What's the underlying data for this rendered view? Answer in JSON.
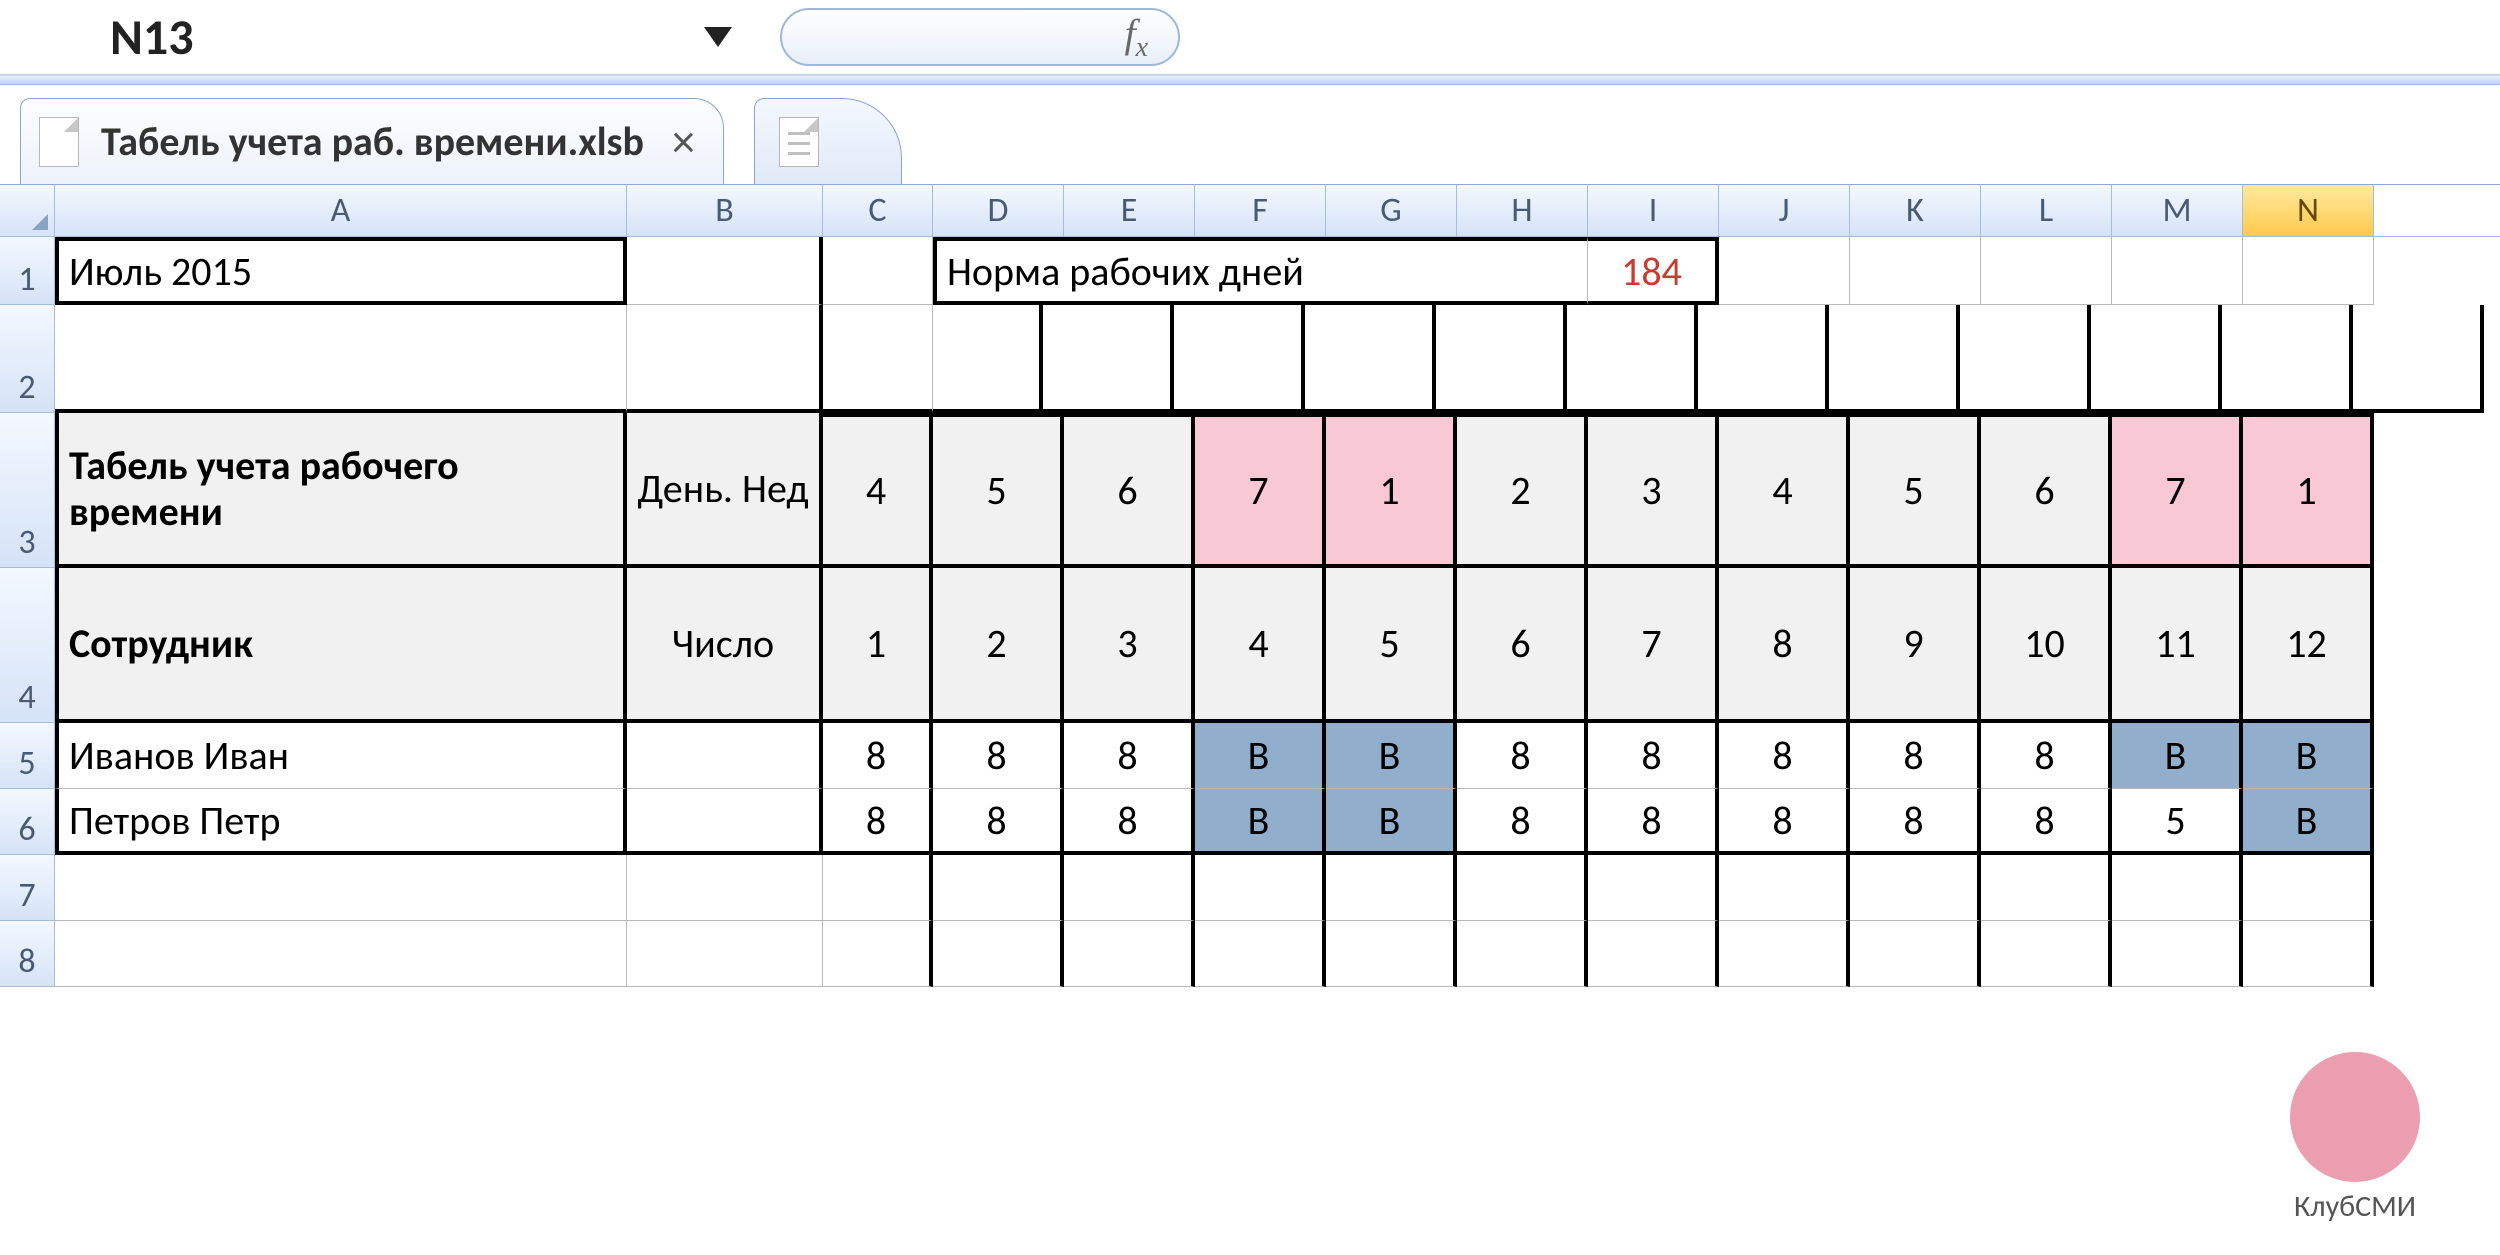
{
  "namebox": {
    "value": "N13"
  },
  "formula_bar": {
    "fx_label": "f"
  },
  "tabs": {
    "main": {
      "title": "Табель учета раб. времени.xlsb"
    }
  },
  "columns": [
    "A",
    "B",
    "C",
    "D",
    "E",
    "F",
    "G",
    "H",
    "I",
    "J",
    "K",
    "L",
    "M",
    "N"
  ],
  "col_widths_class": [
    "wA",
    "wB",
    "wC",
    "wD",
    "wD",
    "wD",
    "wD",
    "wD",
    "wD",
    "wD",
    "wD",
    "wD",
    "wD",
    "wD"
  ],
  "row_numbers": [
    "1",
    "2",
    "3",
    "4",
    "5",
    "6",
    "7",
    "8"
  ],
  "sheet": {
    "period_label": "Июль 2015",
    "norm_label": "Норма рабочих дней",
    "norm_value": "184",
    "header_title": "Табель учета рабочего времени",
    "day_of_week_label": "День. Нед",
    "employee_label": "Сотрудник",
    "date_label": "Число",
    "day_of_week": [
      "4",
      "5",
      "6",
      "7",
      "1",
      "2",
      "3",
      "4",
      "5",
      "6",
      "7",
      "1"
    ],
    "day_of_week_weekend_idx": [
      3,
      4,
      10,
      11
    ],
    "dates": [
      "1",
      "2",
      "3",
      "4",
      "5",
      "6",
      "7",
      "8",
      "9",
      "10",
      "11",
      "12"
    ],
    "employees": [
      {
        "name": "Иванов Иван",
        "hours": [
          "8",
          "8",
          "8",
          "В",
          "В",
          "8",
          "8",
          "8",
          "8",
          "8",
          "В",
          "В"
        ],
        "weekend_idx": [
          3,
          4,
          10,
          11
        ]
      },
      {
        "name": "Петров Петр",
        "hours": [
          "8",
          "8",
          "8",
          "В",
          "В",
          "8",
          "8",
          "8",
          "8",
          "8",
          "5",
          "В"
        ],
        "weekend_idx": [
          3,
          4,
          11
        ]
      }
    ]
  },
  "watermark": {
    "label": "КлубСМИ"
  }
}
